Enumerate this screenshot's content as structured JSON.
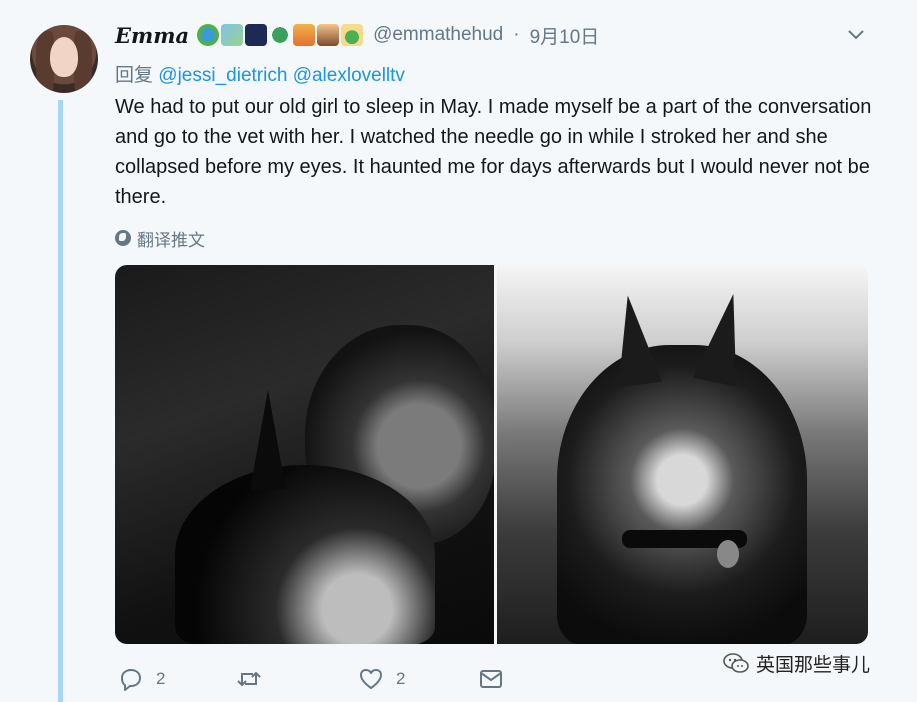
{
  "tweet": {
    "display_name": "Emma",
    "emoji_icons": [
      "earth-globe",
      "world-map",
      "night-city",
      "recycling",
      "sunrise-city",
      "volcano",
      "cactus"
    ],
    "handle": "@emmathehud",
    "separator": "·",
    "date": "9月10日",
    "reply_prefix": "回复",
    "reply_to": [
      "@jessi_dietrich",
      "@alexlovelltv"
    ],
    "text": "We had to put our old girl to sleep in May. I made myself be a part of the conversation and go to the vet with her. I watched the needle go in while I stroked her and she collapsed before my eyes. It haunted me for days afterwards but I would never not be there.",
    "translate_label": "翻译推文"
  },
  "actions": {
    "reply_count": "2",
    "retweet_count": "",
    "like_count": "2"
  },
  "watermark": {
    "text": "英国那些事儿"
  },
  "colors": {
    "background": "#f5f8fa",
    "link": "#1b95e0",
    "muted": "#657786",
    "thread_line": "#a6d8f5"
  }
}
